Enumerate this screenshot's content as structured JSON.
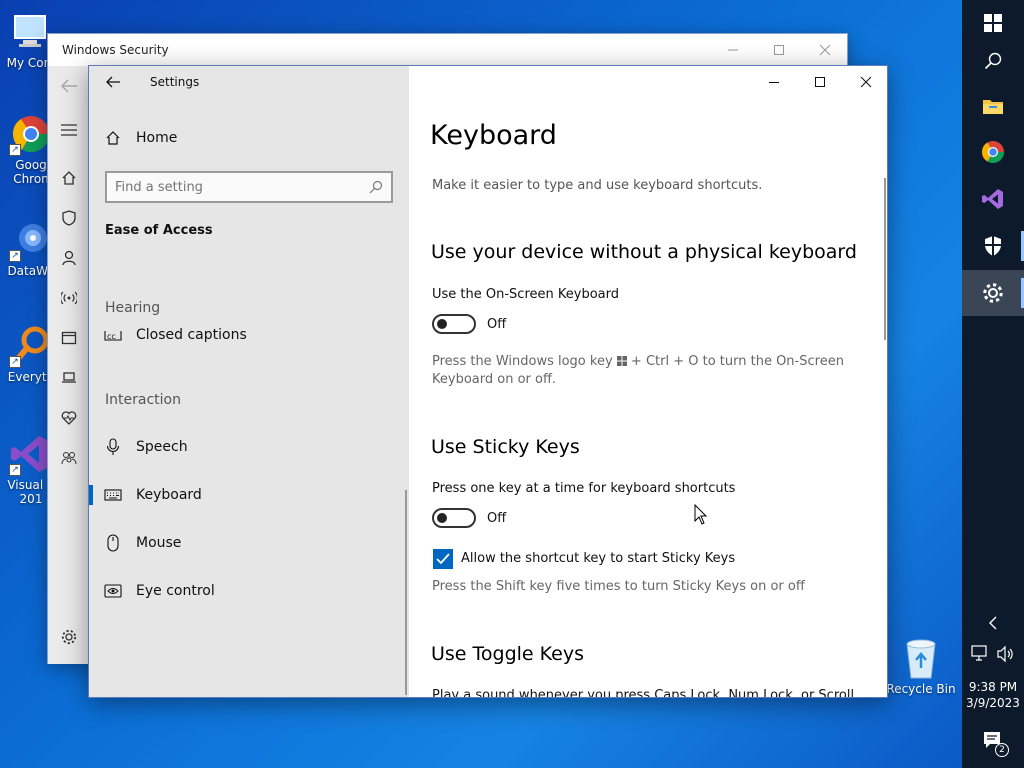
{
  "desktop": {
    "icons": [
      {
        "label": "My Com",
        "icon": "computer-icon"
      },
      {
        "label": "Goog\nChron",
        "icon": "chrome-icon"
      },
      {
        "label": "DataWa",
        "icon": "datawarrior-icon"
      },
      {
        "label": "Everyth",
        "icon": "everything-search-icon"
      },
      {
        "label": "Visual S\n201",
        "icon": "visual-studio-icon"
      }
    ],
    "recycle_bin": "Recycle Bin"
  },
  "taskbar": {
    "buttons": [
      "start-icon",
      "search-icon",
      "file-explorer-icon",
      "chrome-icon",
      "visual-studio-icon",
      "windows-security-icon",
      "settings-icon"
    ],
    "active": "settings-icon",
    "time": "9:38 PM",
    "date": "3/9/2023",
    "notification_count": "2"
  },
  "windows_security": {
    "title": "Windows Security"
  },
  "settings": {
    "window_title": "Settings",
    "home_label": "Home",
    "search_placeholder": "Find a setting",
    "category": "Ease of Access",
    "sections": [
      {
        "header": "Hearing",
        "items": [
          {
            "label": "Closed captions",
            "icon": "closed-captions-icon"
          }
        ]
      },
      {
        "header": "Interaction",
        "items": [
          {
            "label": "Speech",
            "icon": "microphone-icon"
          },
          {
            "label": "Keyboard",
            "icon": "keyboard-icon",
            "selected": true
          },
          {
            "label": "Mouse",
            "icon": "mouse-icon"
          },
          {
            "label": "Eye control",
            "icon": "eye-control-icon"
          }
        ]
      }
    ],
    "content": {
      "title": "Keyboard",
      "subtitle": "Make it easier to type and use keyboard shortcuts.",
      "osk": {
        "heading": "Use your device without a physical keyboard",
        "label": "Use the On-Screen Keyboard",
        "state": "Off",
        "hint_pre": "Press the Windows logo key",
        "hint_post": "+ Ctrl + O to turn the On-Screen Keyboard on or off."
      },
      "sticky": {
        "heading": "Use Sticky Keys",
        "label": "Press one key at a time for keyboard shortcuts",
        "state": "Off",
        "checkbox_label": "Allow the shortcut key to start Sticky Keys",
        "checkbox_checked": true,
        "hint": "Press the Shift key five times to turn Sticky Keys on or off"
      },
      "toggle": {
        "heading": "Use Toggle Keys",
        "cutoff_text": "Play a sound whenever you press Caps Lock, Num Lock, or Scroll"
      }
    }
  }
}
